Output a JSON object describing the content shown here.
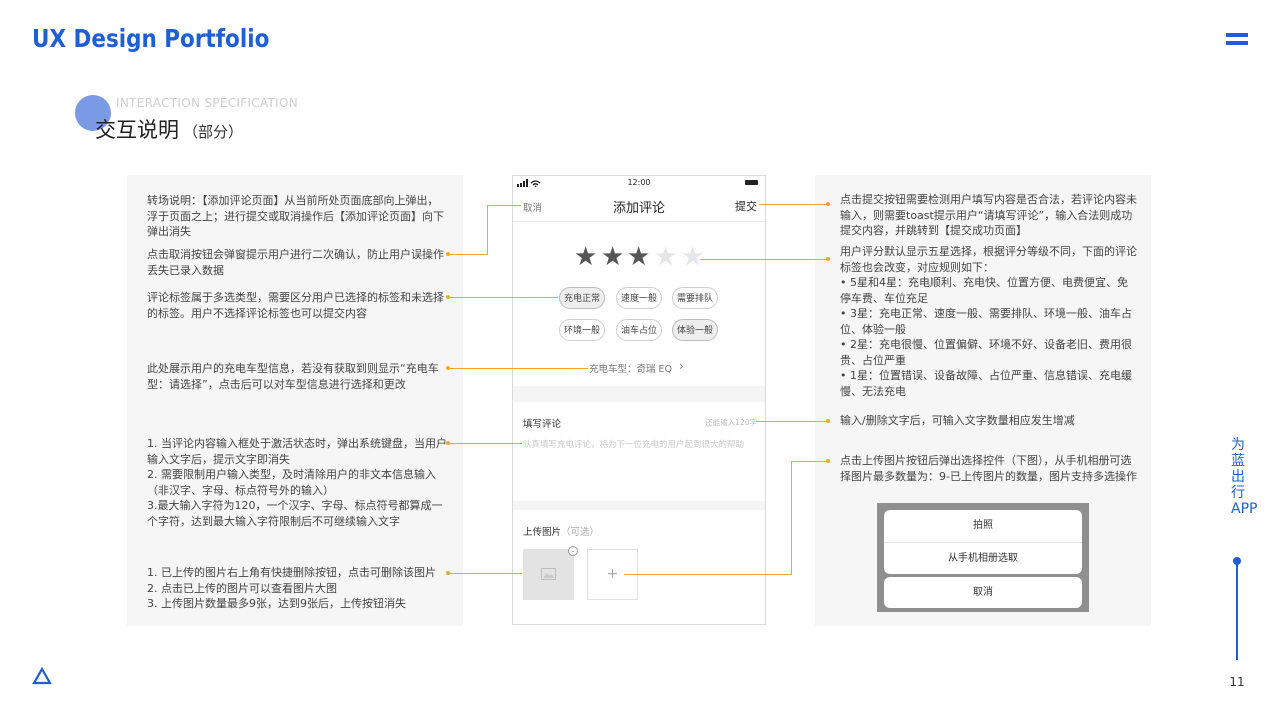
{
  "brand": "UX Design Portfolio",
  "section": {
    "en": "INTERACTION SPECIFICATION",
    "zh": "交互说明",
    "zh_sub": "（部分）"
  },
  "left_notes": [
    "转场说明：【添加评论页面】从当前所处页面底部向上弹出，浮于页面之上；进行提交或取消操作后【添加评论页面】向下弹出消失",
    "点击取消按钮会弹窗提示用户进行二次确认，防止用户误操作丢失已录入数据",
    "评论标签属于多选类型，需要区分用户已选择的标签和未选择的标签。用户不选择评论标签也可以提交内容",
    "此处展示用户的充电车型信息，若没有获取到则显示“充电车型：请选择”，点击后可以对车型信息进行选择和更改",
    "1. 当评论内容输入框处于激活状态时，弹出系统键盘，当用户输入文字后，提示文字即消失\n2. 需要限制用户输入类型，及时清除用户的非文本信息输入（非汉字、字母、标点符号外的输入）\n3.最大输入字符为120，一个汉字、字母、标点符号都算成一个字符，达到最大输入字符限制后不可继续输入文字",
    "1. 已上传的图片右上角有快捷删除按钮，点击可删除该图片\n2. 点击已上传的图片可以查看图片大图\n3. 上传图片数量最多9张，达到9张后，上传按钮消失"
  ],
  "right_notes": [
    "点击提交按钮需要检测用户填写内容是否合法，若评论内容未输入，则需要toast提示用户“请填写评论”，输入合法则成功提交内容，并跳转到【提交成功页面】",
    "用户评分默认显示五星选择，根据评分等级不同，下面的评论标签也会改变，对应规则如下：\n • 5星和4星：充电顺利、充电快、位置方便、电费便宜、免停车费、车位充足\n • 3星：充电正常、速度一般、需要排队、环境一般、油车占位、体验一般\n • 2星：充电很慢、位置偏僻、环境不好、设备老旧、费用很贵、占位严重\n • 1星：位置错误、设备故障、占位严重、信息错误、充电缓慢、无法充电",
    "输入/删除文字后，可输入文字数量相应发生增减",
    "点击上传图片按钮后弹出选择控件（下图），从手机相册可选择图片最多数量为：9-已上传图片的数量，图片支持多选操作"
  ],
  "phone": {
    "status_time": "12:00",
    "cancel": "取消",
    "title": "添加评论",
    "submit": "提交",
    "rating": {
      "value": 3,
      "max": 5
    },
    "tags": [
      {
        "label": "充电正常",
        "selected": true
      },
      {
        "label": "速度一般",
        "selected": false
      },
      {
        "label": "需要排队",
        "selected": false
      },
      {
        "label": "环境一般",
        "selected": false
      },
      {
        "label": "油车占位",
        "selected": false
      },
      {
        "label": "体验一般",
        "selected": true
      }
    ],
    "car_model": "充电车型：奇瑞 EQ",
    "comment_label": "填写评论",
    "comment_counter": "还能输入120字",
    "comment_placeholder": "认真填写充电评论，将为下一位充电的用户起到很大的帮助",
    "upload_label": "上传图片",
    "upload_optional": "（可选）",
    "add_symbol": "+"
  },
  "action_sheet": {
    "take_photo": "拍照",
    "from_album": "从手机相册选取",
    "cancel": "取消"
  },
  "vertical_title": "为蓝出行APP",
  "page_number": "11",
  "colors": {
    "accent": "#1f5fd6",
    "annotation_line": "#f5a623",
    "star_on": "#555555",
    "star_off": "#e6e6e6"
  }
}
